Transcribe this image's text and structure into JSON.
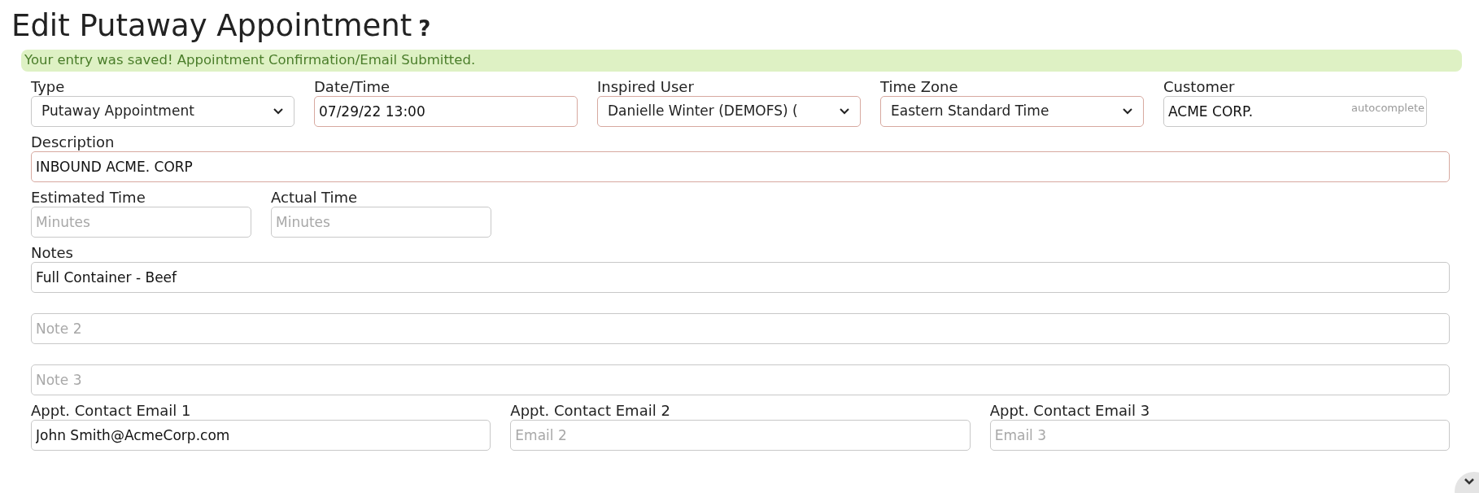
{
  "title": "Edit Putaway Appointment",
  "help_mark": "?",
  "alert": {
    "text": "Your entry was saved! Appointment Confirmation/Email Submitted."
  },
  "form_rows": [
    [
      {
        "kind": "select",
        "label": "Type",
        "value": "Putaway Appointment",
        "required": false
      },
      {
        "kind": "input",
        "label": "Date/Time",
        "value": "07/29/22 13:00",
        "required": true
      },
      {
        "kind": "select",
        "label": "Inspired User",
        "value": "Danielle Winter (DEMOFS) (",
        "required": true
      },
      {
        "kind": "select",
        "label": "Time Zone",
        "value": "Eastern Standard Time",
        "required": true
      },
      {
        "kind": "input",
        "label": "Customer",
        "value": "ACME CORP.",
        "hint": "autocomplete",
        "required": false
      }
    ],
    [
      {
        "kind": "input",
        "label": "Description",
        "value": "INBOUND ACME. CORP",
        "required": true
      }
    ],
    [
      {
        "kind": "input",
        "label": "Estimated Time",
        "placeholder": "Minutes",
        "required": false
      },
      {
        "kind": "input",
        "label": "Actual Time",
        "placeholder": "Minutes",
        "required": false
      }
    ],
    [
      {
        "kind": "input",
        "label": "Notes",
        "value": "Full Container - Beef",
        "required": false
      }
    ],
    [
      {
        "kind": "input",
        "placeholder": "Note 2",
        "required": false
      }
    ],
    [
      {
        "kind": "input",
        "placeholder": "Note 3",
        "required": false
      }
    ],
    [
      {
        "kind": "input",
        "label": "Appt. Contact Email 1",
        "value": "John Smith@AcmeCorp.com",
        "required": false
      },
      {
        "kind": "input",
        "label": "Appt. Contact Email 2",
        "placeholder": "Email 2",
        "required": false
      },
      {
        "kind": "input",
        "label": "Appt. Contact Email 3",
        "placeholder": "Email 3",
        "required": false
      }
    ]
  ]
}
